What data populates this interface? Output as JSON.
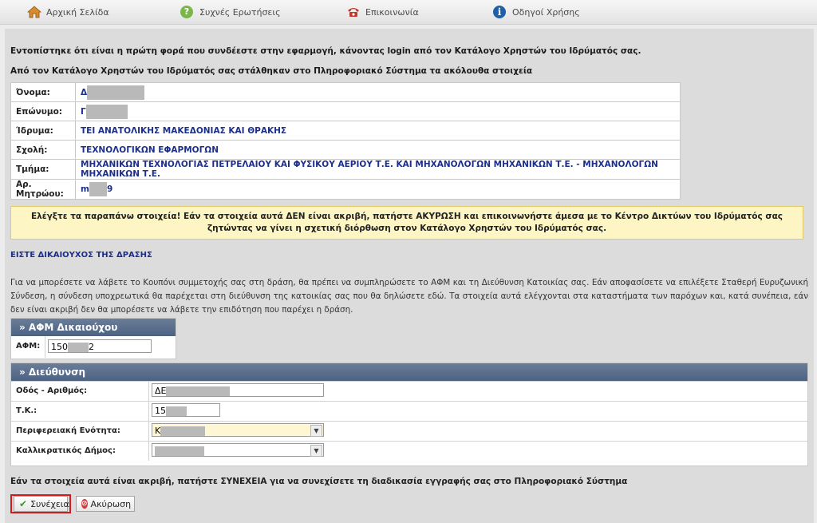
{
  "nav": {
    "home": "Αρχική Σελίδα",
    "faq": "Συχνές Ερωτήσεις",
    "contact": "Επικοινωνία",
    "guides": "Οδηγοί Χρήσης"
  },
  "intro": {
    "first_login": "Εντοπίστηκε ότι είναι η πρώτη φορά που συνδέεστε στην εφαρμογή, κάνοντας login από τον Κατάλογο Χρηστών του Ιδρύματός σας.",
    "sent_data": "Από τον Κατάλογο Χρηστών του Ιδρύματός σας στάλθηκαν στο Πληροφοριακό Σύστημα τα ακόλουθα στοιχεία"
  },
  "user_info": {
    "rows": [
      {
        "label": "Όνομα:",
        "value": "Δ"
      },
      {
        "label": "Επώνυμο:",
        "value": "Γ"
      },
      {
        "label": "Ίδρυμα:",
        "value": "ΤΕΙ ΑΝΑΤΟΛΙΚΗΣ ΜΑΚΕΔΟΝΙΑΣ ΚΑΙ ΘΡΑΚΗΣ"
      },
      {
        "label": "Σχολή:",
        "value": "ΤΕΧΝΟΛΟΓΙΚΩΝ ΕΦΑΡΜΟΓΩΝ"
      },
      {
        "label": "Τμήμα:",
        "value": "ΜΗΧΑΝΙΚΩΝ ΤΕΧΝΟΛΟΓΙΑΣ ΠΕΤΡΕΛΑΙΟΥ ΚΑΙ ΦΥΣΙΚΟΥ ΑΕΡΙΟΥ Τ.Ε. ΚΑΙ ΜΗΧΑΝΟΛΟΓΩΝ ΜΗΧΑΝΙΚΩΝ Τ.Ε. - ΜΗΧΑΝΟΛΟΓΩΝ ΜΗΧΑΝΙΚΩΝ Τ.Ε."
      },
      {
        "label": "Αρ. Μητρώου:",
        "value_prefix": "m",
        "value_suffix": "9"
      }
    ]
  },
  "warning": "Ελέγξτε τα παραπάνω στοιχεία! Εάν τα στοιχεία αυτά ΔΕΝ είναι ακριβή, πατήστε ΑΚΥΡΩΣΗ και επικοινωνήστε άμεσα με το Κέντρο Δικτύων του Ιδρύματός σας ζητώντας να γίνει η σχετική διόρθωση στον Κατάλογο Χρηστών του Ιδρύματός σας.",
  "eligible": "ΕΙΣΤΕ ΔΙΚΑΙΟΥΧΟΣ ΤΗΣ ΔΡΑΣΗΣ",
  "instructions": "Για να μπορέσετε να λάβετε το Κουπόνι συμμετοχής σας στη δράση, θα πρέπει να συμπληρώσετε το ΑΦΜ και τη Διεύθυνση Κατοικίας σας. Εάν αποφασίσετε να επιλέξετε Σταθερή Ευρυζωνική Σύνδεση, η σύνδεση υποχρεωτικά θα παρέχεται στη διεύθυνση της κατοικίας σας που θα δηλώσετε εδώ. Τα στοιχεία αυτά ελέγχονται στα καταστήματα των παρόχων και, κατά συνέπεια, εάν δεν είναι ακριβή δεν θα μπορέσετε να λάβετε την επιδότηση που παρέχει η δράση.",
  "afm_panel": {
    "title": "» ΑΦΜ Δικαιούχου",
    "label": "ΑΦΜ:",
    "value_prefix": "150",
    "value_suffix": "2"
  },
  "address_panel": {
    "title": "» Διεύθυνση",
    "street_label": "Οδός - Αριθμός:",
    "street_value": "ΔΕ",
    "postal_label": "Τ.Κ.:",
    "postal_value": "15",
    "region_label": "Περιφερειακή Ενότητα:",
    "region_value": "Κ",
    "municipality_label": "Καλλικρατικός Δήμος:",
    "municipality_value": ""
  },
  "confirm_text": "Εάν τα στοιχεία αυτά είναι ακριβή, πατήστε ΣΥΝΕΧΕΙΑ για να συνεχίσετε τη διαδικασία εγγραφής σας στο Πληροφοριακό Σύστημα",
  "buttons": {
    "continue": "Συνέχεια",
    "cancel": "Ακύρωση"
  },
  "colors": {
    "panel_header": "#4d6182",
    "link_blue": "#1d2f8c",
    "warning_bg": "#fdf6c4",
    "highlight_border": "#d21c1c"
  }
}
